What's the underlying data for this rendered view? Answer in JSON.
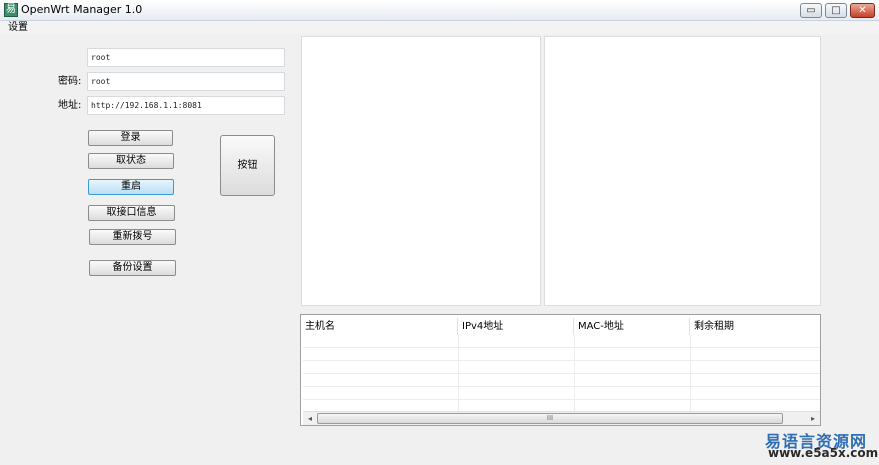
{
  "window": {
    "title": "OpenWrt Manager 1.0",
    "icon_glyph": "易",
    "controls": {
      "minimize": "▭",
      "maximize": "□",
      "close": "✕"
    }
  },
  "menu": {
    "settings": "设置"
  },
  "form": {
    "username_value": "root",
    "password_label": "密码:",
    "password_value": "root",
    "address_label": "地址:",
    "address_value": "http://192.168.1.1:8081"
  },
  "buttons": {
    "login": "登录",
    "get_status": "取状态",
    "restart": "重启",
    "get_interface_info": "取接口信息",
    "redial": "重新拨号",
    "backup_settings": "备份设置",
    "generic": "按钮"
  },
  "list": {
    "columns": [
      "主机名",
      "IPv4地址",
      "MAC-地址",
      "剩余租期"
    ],
    "rows": []
  },
  "scrollbar": {
    "left_arrow": "◂",
    "right_arrow": "▸",
    "thumb_grip": "III"
  },
  "watermark": {
    "name": "易语言资源网",
    "url": "www.e5a5x.com"
  },
  "colors": {
    "accent": "#3c9ad6",
    "watermark_blue": "#2f6eb5"
  }
}
